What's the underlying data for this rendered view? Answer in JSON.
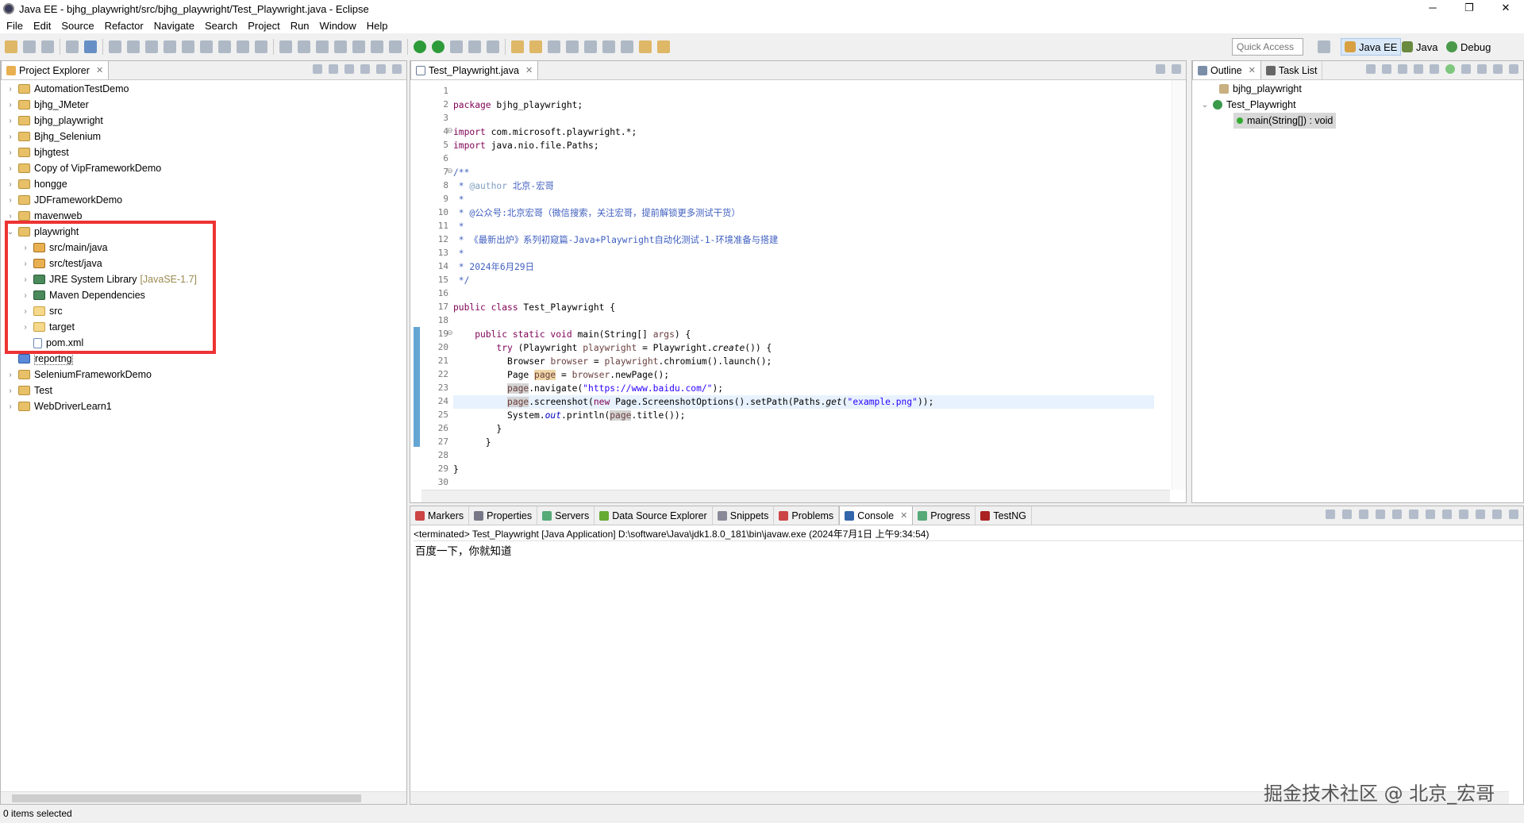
{
  "window": {
    "title": "Java EE - bjhg_playwright/src/bjhg_playwright/Test_Playwright.java - Eclipse",
    "minimize": "─",
    "restore": "❐",
    "close": "✕"
  },
  "menu": [
    "File",
    "Edit",
    "Source",
    "Refactor",
    "Navigate",
    "Search",
    "Project",
    "Run",
    "Window",
    "Help"
  ],
  "quick_access": {
    "placeholder": "Quick Access"
  },
  "perspectives": [
    {
      "label": "Java EE",
      "active": true
    },
    {
      "label": "Java"
    },
    {
      "label": "Debug"
    }
  ],
  "project_explorer": {
    "tab": "Project Explorer",
    "items": [
      {
        "label": "AutomationTestDemo",
        "level": 0,
        "icon": "project",
        "expandable": true
      },
      {
        "label": "bjhg_JMeter",
        "level": 0,
        "icon": "project",
        "expandable": true
      },
      {
        "label": "bjhg_playwright",
        "level": 0,
        "icon": "project",
        "expandable": true
      },
      {
        "label": "Bjhg_Selenium",
        "level": 0,
        "icon": "project",
        "expandable": true
      },
      {
        "label": "bjhgtest",
        "level": 0,
        "icon": "project",
        "expandable": true
      },
      {
        "label": "Copy of VipFrameworkDemo",
        "level": 0,
        "icon": "project",
        "expandable": true
      },
      {
        "label": "hongge",
        "level": 0,
        "icon": "project",
        "expandable": true
      },
      {
        "label": "JDFrameworkDemo",
        "level": 0,
        "icon": "project",
        "expandable": true
      },
      {
        "label": "mavenweb",
        "level": 0,
        "icon": "project",
        "expandable": true
      },
      {
        "label": "playwright",
        "level": 0,
        "icon": "project",
        "expandable": true,
        "expanded": true
      },
      {
        "label": "src/main/java",
        "level": 1,
        "icon": "package-folder",
        "expandable": true
      },
      {
        "label": "src/test/java",
        "level": 1,
        "icon": "package-folder",
        "expandable": true
      },
      {
        "label": "JRE System Library",
        "decoration": "[JavaSE-1.7]",
        "level": 1,
        "icon": "library",
        "expandable": true
      },
      {
        "label": "Maven Dependencies",
        "level": 1,
        "icon": "library",
        "expandable": true
      },
      {
        "label": "src",
        "level": 1,
        "icon": "folder",
        "expandable": true
      },
      {
        "label": "target",
        "level": 1,
        "icon": "folder",
        "expandable": true
      },
      {
        "label": "pom.xml",
        "level": 1,
        "icon": "xml-file",
        "expandable": false
      },
      {
        "label": "reportng",
        "level": 0,
        "icon": "reportng",
        "expandable": false
      },
      {
        "label": "SeleniumFrameworkDemo",
        "level": 0,
        "icon": "project",
        "expandable": true
      },
      {
        "label": "Test",
        "level": 0,
        "icon": "project",
        "expandable": true
      },
      {
        "label": "WebDriverLearn1",
        "level": 0,
        "icon": "project",
        "expandable": true
      }
    ]
  },
  "editor": {
    "tab": "Test_Playwright.java",
    "current_line": 24,
    "lines": [
      [],
      [
        [
          "package",
          "kw"
        ],
        [
          " bjhg_playwright;",
          ""
        ]
      ],
      [],
      [
        [
          "import",
          "kw"
        ],
        [
          " com.microsoft.playwright.*;",
          ""
        ]
      ],
      [
        [
          "import",
          "kw"
        ],
        [
          " java.nio.file.Paths;",
          ""
        ]
      ],
      [],
      [
        [
          "/**",
          "cm"
        ]
      ],
      [
        [
          " * ",
          "cm"
        ],
        [
          "@author",
          "tag"
        ],
        [
          " 北京-宏哥",
          "cm"
        ]
      ],
      [
        [
          " *",
          "cm"
        ]
      ],
      [
        [
          " * @公众号:北京宏哥（微信搜索，关注宏哥，提前解锁更多测试干货）",
          "cm"
        ]
      ],
      [
        [
          " *",
          "cm"
        ]
      ],
      [
        [
          " * 《最新出炉》系列初窥篇-Java+Playwright自动化测试-1-环境准备与搭建",
          "cm"
        ]
      ],
      [
        [
          " *",
          "cm"
        ]
      ],
      [
        [
          " * 2024年6月29日",
          "cm"
        ]
      ],
      [
        [
          " */",
          "cm"
        ]
      ],
      [],
      [
        [
          "public class",
          "kw"
        ],
        [
          " Test_Playwright {",
          ""
        ]
      ],
      [],
      [
        [
          "    ",
          ""
        ],
        [
          "public static void",
          "kw"
        ],
        [
          " main(String[] ",
          ""
        ],
        [
          "args",
          "var"
        ],
        [
          ") {",
          ""
        ]
      ],
      [
        [
          "        ",
          ""
        ],
        [
          "try",
          "kw"
        ],
        [
          " (Playwright ",
          ""
        ],
        [
          "playwright",
          "var"
        ],
        [
          " = Playwright.",
          ""
        ],
        [
          "create",
          "it"
        ],
        [
          "()) {",
          ""
        ]
      ],
      [
        [
          "          Browser ",
          ""
        ],
        [
          "browser",
          "var"
        ],
        [
          " = ",
          ""
        ],
        [
          "playwright",
          "var"
        ],
        [
          ".chromium().launch();",
          ""
        ]
      ],
      [
        [
          "          Page ",
          ""
        ],
        [
          "page",
          "var occw"
        ],
        [
          " = ",
          ""
        ],
        [
          "browser",
          "var"
        ],
        [
          ".newPage();",
          ""
        ]
      ],
      [
        [
          "          ",
          ""
        ],
        [
          "page",
          "var occ"
        ],
        [
          ".navigate(",
          ""
        ],
        [
          "\"https://www.baidu.com/\"",
          "str"
        ],
        [
          ");",
          ""
        ]
      ],
      [
        [
          "          ",
          ""
        ],
        [
          "page",
          "var occ"
        ],
        [
          ".screenshot(",
          ""
        ],
        [
          "new",
          "kw"
        ],
        [
          " Page.ScreenshotOptions().setPath(Paths.",
          ""
        ],
        [
          "get",
          "it"
        ],
        [
          "(",
          ""
        ],
        [
          "\"example.png\"",
          "str"
        ],
        [
          "));",
          ""
        ]
      ],
      [
        [
          "          System.",
          ""
        ],
        [
          "out",
          "fld"
        ],
        [
          ".println(",
          ""
        ],
        [
          "page",
          "var occ"
        ],
        [
          ".title());",
          ""
        ]
      ],
      [
        [
          "        }",
          ""
        ]
      ],
      [
        [
          "      }",
          ""
        ]
      ],
      [],
      [
        [
          "}",
          ""
        ]
      ],
      []
    ]
  },
  "outline": {
    "tabs": [
      "Outline",
      "Task List"
    ],
    "items": [
      {
        "label": "bjhg_playwright",
        "level": 0,
        "icon": "package"
      },
      {
        "label": "Test_Playwright",
        "level": 0,
        "icon": "class",
        "expanded": true
      },
      {
        "label": "main(String[]) : void",
        "level": 1,
        "icon": "public-static-method",
        "selected": true
      }
    ]
  },
  "bottom": {
    "tabs": [
      "Markers",
      "Properties",
      "Servers",
      "Data Source Explorer",
      "Snippets",
      "Problems",
      "Console",
      "Progress",
      "TestNG"
    ],
    "active_tab": "Console",
    "console_header": "<terminated> Test_Playwright [Java Application] D:\\software\\Java\\jdk1.8.0_181\\bin\\javaw.exe (2024年7月1日 上午9:34:54)",
    "console_output": "百度一下，你就知道"
  },
  "status": {
    "text": "0 items selected"
  },
  "watermark": "掘金技术社区 @ 北京_宏哥",
  "colors": {
    "highlight_box": "#ee3333",
    "keyword": "#7f0055",
    "comment": "#3f5fbf",
    "string": "#2a00ff",
    "perspective_active": "#d9e8f8"
  }
}
